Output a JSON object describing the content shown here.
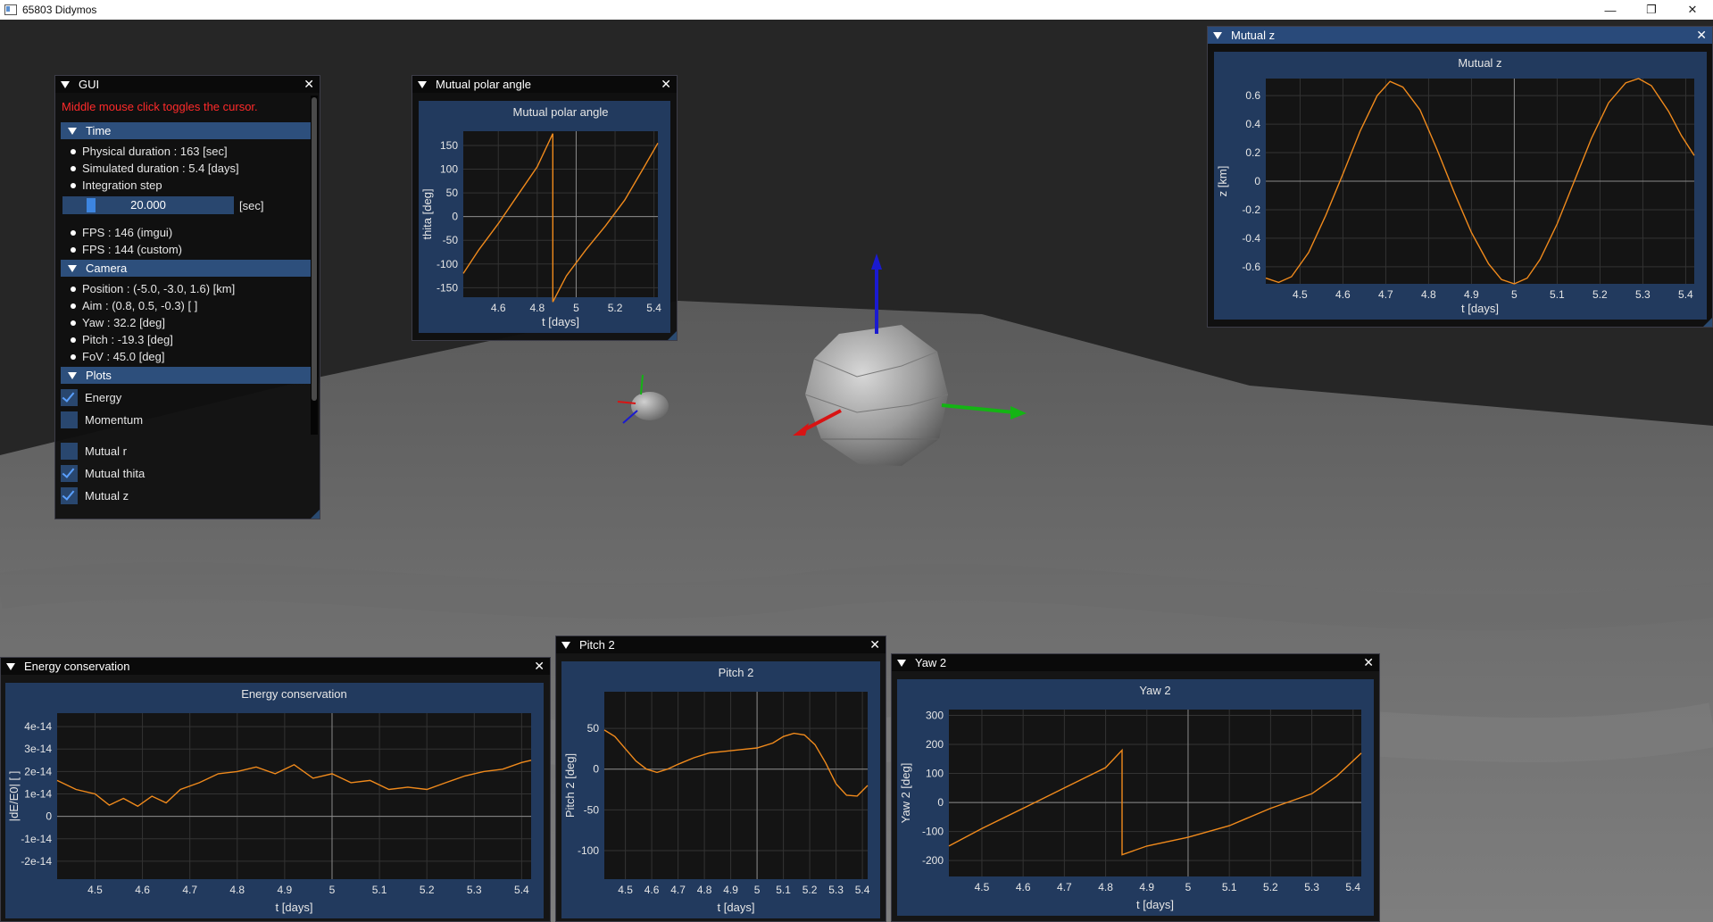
{
  "window": {
    "title": "65803 Didymos",
    "min_icon": "minimize-icon",
    "max_icon": "restore-icon",
    "close_icon": "close-icon"
  },
  "gui": {
    "title": "GUI",
    "hint": "Middle mouse click toggles the cursor.",
    "time": {
      "header": "Time",
      "physical": "Physical duration : 163 [sec]",
      "simulated": "Simulated duration : 5.4 [days]",
      "step_label": "Integration step",
      "step_value": "20.000",
      "step_unit": "[sec]",
      "step_fraction": 0.15,
      "fps_imgui": "FPS : 146 (imgui)",
      "fps_custom": "FPS : 144 (custom)"
    },
    "camera": {
      "header": "Camera",
      "position": "Position : (-5.0, -3.0, 1.6) [km]",
      "aim": "Aim : (0.8, 0.5, -0.3) [ ]",
      "yaw": "Yaw : 32.2 [deg]",
      "pitch": "Pitch : -19.3 [deg]",
      "fov": "FoV : 45.0 [deg]"
    },
    "plots": {
      "header": "Plots",
      "items": [
        {
          "label": "Energy",
          "checked": true
        },
        {
          "label": "Momentum",
          "checked": false
        },
        {
          "label": "Mutual r",
          "checked": false
        },
        {
          "label": "Mutual thita",
          "checked": true
        },
        {
          "label": "Mutual z",
          "checked": true
        }
      ]
    }
  },
  "windows": {
    "polar": {
      "title": "Mutual polar angle"
    },
    "mutualz": {
      "title": "Mutual z"
    },
    "energy": {
      "title": "Energy conservation"
    },
    "pitch": {
      "title": "Pitch 2"
    },
    "yaw": {
      "title": "Yaw 2"
    }
  },
  "colors": {
    "accent": "#294a7a",
    "series": "#f08a1c",
    "hint": "#ff2a2a"
  },
  "chart_data": [
    {
      "id": "polar",
      "type": "line",
      "title": "Mutual polar angle",
      "xlabel": "t [days]",
      "ylabel": "thita [deg]",
      "xlim": [
        4.42,
        5.42
      ],
      "ylim": [
        -170,
        180
      ],
      "xticks": [
        4.6,
        4.8,
        5,
        5.2,
        5.4
      ],
      "xticklabels": [
        "4.6",
        "4.8",
        "5",
        "5.2",
        "5.4"
      ],
      "yticks": [
        150,
        100,
        50,
        0,
        -50,
        -100,
        -150
      ],
      "yticklabels": [
        "150",
        "100",
        "50",
        "0",
        "-50",
        "-100",
        "-150"
      ],
      "series": [
        {
          "x": [
            4.42,
            4.5,
            4.6,
            4.7,
            4.8,
            4.88,
            4.88,
            4.95,
            5.05,
            5.15,
            5.25,
            5.35,
            5.42
          ],
          "y": [
            -120,
            -70,
            -15,
            45,
            105,
            175,
            -180,
            -125,
            -70,
            -20,
            35,
            105,
            155
          ]
        }
      ]
    },
    {
      "id": "mutualz",
      "type": "line",
      "title": "Mutual z",
      "xlabel": "t [days]",
      "ylabel": "z [km]",
      "xlim": [
        4.42,
        5.42
      ],
      "ylim": [
        -0.72,
        0.72
      ],
      "xticks": [
        4.5,
        4.6,
        4.7,
        4.8,
        4.9,
        5,
        5.1,
        5.2,
        5.3,
        5.4
      ],
      "xticklabels": [
        "4.5",
        "4.6",
        "4.7",
        "4.8",
        "4.9",
        "5",
        "5.1",
        "5.2",
        "5.3",
        "5.4"
      ],
      "yticks": [
        0.6,
        0.4,
        0.2,
        0,
        -0.2,
        -0.4,
        -0.6
      ],
      "yticklabels": [
        "0.6",
        "0.4",
        "0.2",
        "0",
        "-0.2",
        "-0.4",
        "-0.6"
      ],
      "series": [
        {
          "x": [
            4.42,
            4.45,
            4.48,
            4.52,
            4.56,
            4.6,
            4.64,
            4.68,
            4.71,
            4.74,
            4.78,
            4.82,
            4.86,
            4.9,
            4.94,
            4.97,
            5.0,
            5.03,
            5.06,
            5.1,
            5.14,
            5.18,
            5.22,
            5.26,
            5.29,
            5.32,
            5.36,
            5.39,
            5.42
          ],
          "y": [
            -0.68,
            -0.71,
            -0.67,
            -0.5,
            -0.24,
            0.05,
            0.35,
            0.6,
            0.7,
            0.66,
            0.5,
            0.22,
            -0.08,
            -0.36,
            -0.58,
            -0.69,
            -0.72,
            -0.68,
            -0.55,
            -0.3,
            0.0,
            0.3,
            0.55,
            0.69,
            0.72,
            0.67,
            0.49,
            0.32,
            0.18
          ]
        }
      ]
    },
    {
      "id": "energy",
      "type": "line",
      "title": "Energy conservation",
      "xlabel": "t [days]",
      "ylabel": "|dE/E0| [ ]",
      "xlim": [
        4.42,
        5.42
      ],
      "ylim": [
        -2.8e-14,
        4.6e-14
      ],
      "xticks": [
        4.5,
        4.6,
        4.7,
        4.8,
        4.9,
        5,
        5.1,
        5.2,
        5.3,
        5.4
      ],
      "xticklabels": [
        "4.5",
        "4.6",
        "4.7",
        "4.8",
        "4.9",
        "5",
        "5.1",
        "5.2",
        "5.3",
        "5.4"
      ],
      "yticks": [
        4e-14,
        3e-14,
        2e-14,
        1e-14,
        0,
        -1e-14,
        -2e-14
      ],
      "yticklabels": [
        "4e-14",
        "3e-14",
        "2e-14",
        "1e-14",
        "0",
        "-1e-14",
        "-2e-14"
      ],
      "series": [
        {
          "x": [
            4.42,
            4.46,
            4.5,
            4.53,
            4.56,
            4.59,
            4.62,
            4.65,
            4.68,
            4.72,
            4.76,
            4.8,
            4.84,
            4.88,
            4.92,
            4.96,
            5.0,
            5.04,
            5.08,
            5.12,
            5.16,
            5.2,
            5.24,
            5.28,
            5.32,
            5.36,
            5.4,
            5.42
          ],
          "y": [
            1.6e-14,
            1.2e-14,
            1e-14,
            5e-15,
            8e-15,
            4.5e-15,
            9e-15,
            6e-15,
            1.2e-14,
            1.5e-14,
            1.9e-14,
            2e-14,
            2.2e-14,
            1.9e-14,
            2.3e-14,
            1.7e-14,
            1.9e-14,
            1.5e-14,
            1.6e-14,
            1.2e-14,
            1.3e-14,
            1.2e-14,
            1.5e-14,
            1.8e-14,
            2e-14,
            2.1e-14,
            2.4e-14,
            2.5e-14
          ]
        }
      ]
    },
    {
      "id": "pitch",
      "type": "line",
      "title": "Pitch 2",
      "xlabel": "t [days]",
      "ylabel": "Pitch 2 [deg]",
      "xlim": [
        4.42,
        5.42
      ],
      "ylim": [
        -135,
        95
      ],
      "xticks": [
        4.5,
        4.6,
        4.7,
        4.8,
        4.9,
        5,
        5.1,
        5.2,
        5.3,
        5.4
      ],
      "xticklabels": [
        "4.5",
        "4.6",
        "4.7",
        "4.8",
        "4.9",
        "5",
        "5.1",
        "5.2",
        "5.3",
        "5.4"
      ],
      "yticks": [
        50,
        0,
        -50,
        -100
      ],
      "yticklabels": [
        "50",
        "0",
        "-50",
        "-100"
      ],
      "series": [
        {
          "x": [
            4.42,
            4.46,
            4.5,
            4.54,
            4.58,
            4.62,
            4.66,
            4.7,
            4.76,
            4.82,
            4.88,
            4.94,
            5.0,
            5.06,
            5.1,
            5.14,
            5.18,
            5.22,
            5.26,
            5.3,
            5.34,
            5.38,
            5.42
          ],
          "y": [
            48,
            40,
            25,
            10,
            0,
            -4,
            0,
            6,
            14,
            20,
            22,
            24,
            26,
            32,
            40,
            44,
            42,
            30,
            8,
            -18,
            -32,
            -33,
            -20
          ]
        }
      ]
    },
    {
      "id": "yaw",
      "type": "line",
      "title": "Yaw 2",
      "xlabel": "t [days]",
      "ylabel": "Yaw 2 [deg]",
      "xlim": [
        4.42,
        5.42
      ],
      "ylim": [
        -255,
        320
      ],
      "xticks": [
        4.5,
        4.6,
        4.7,
        4.8,
        4.9,
        5,
        5.1,
        5.2,
        5.3,
        5.4
      ],
      "xticklabels": [
        "4.5",
        "4.6",
        "4.7",
        "4.8",
        "4.9",
        "5",
        "5.1",
        "5.2",
        "5.3",
        "5.4"
      ],
      "yticks": [
        300,
        200,
        100,
        0,
        -100,
        -200
      ],
      "yticklabels": [
        "300",
        "200",
        "100",
        "0",
        "-100",
        "-200"
      ],
      "series": [
        {
          "x": [
            4.42,
            4.5,
            4.6,
            4.7,
            4.8,
            4.84,
            4.84,
            4.9,
            5.0,
            5.1,
            5.2,
            5.3,
            5.36,
            5.42
          ],
          "y": [
            -150,
            -90,
            -20,
            50,
            120,
            180,
            -180,
            -150,
            -120,
            -80,
            -20,
            30,
            90,
            170
          ]
        }
      ]
    }
  ]
}
